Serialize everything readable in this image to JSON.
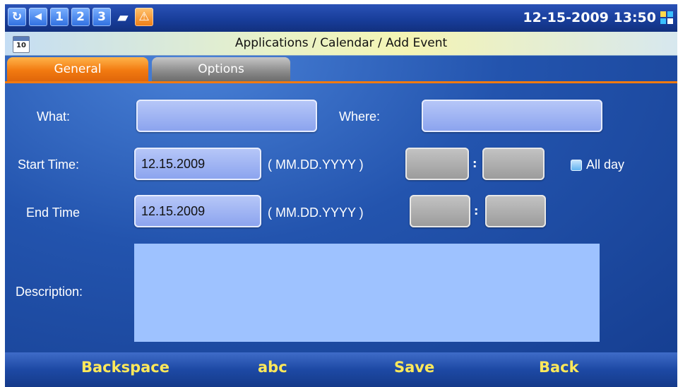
{
  "statusbar": {
    "icons": [
      {
        "name": "refresh-icon",
        "glyph": "↻"
      },
      {
        "name": "volume-icon",
        "glyph": "◀"
      },
      {
        "name": "line-1-icon",
        "glyph": "1"
      },
      {
        "name": "line-2-icon",
        "glyph": "2"
      },
      {
        "name": "line-3-icon",
        "glyph": "3"
      },
      {
        "name": "folder-icon",
        "glyph": "▰"
      },
      {
        "name": "warning-icon",
        "glyph": "⚠"
      }
    ],
    "clock": "12-15-2009 13:50"
  },
  "titlebar": {
    "calendar_icon_text": "10",
    "title": "Applications / Calendar / Add Event"
  },
  "tabs": {
    "general": "General",
    "options": "Options"
  },
  "form": {
    "what_label": "What:",
    "where_label": "Where:",
    "start_label": "Start Time:",
    "end_label": "End Time",
    "date_format": "( MM.DD.YYYY )",
    "start_date": "12.15.2009",
    "end_date": "12.15.2009",
    "colon": ":",
    "all_day_label": "All day",
    "description_label": "Description:"
  },
  "softkeys": {
    "backspace": "Backspace",
    "abc": "abc",
    "save": "Save",
    "back": "Back"
  }
}
